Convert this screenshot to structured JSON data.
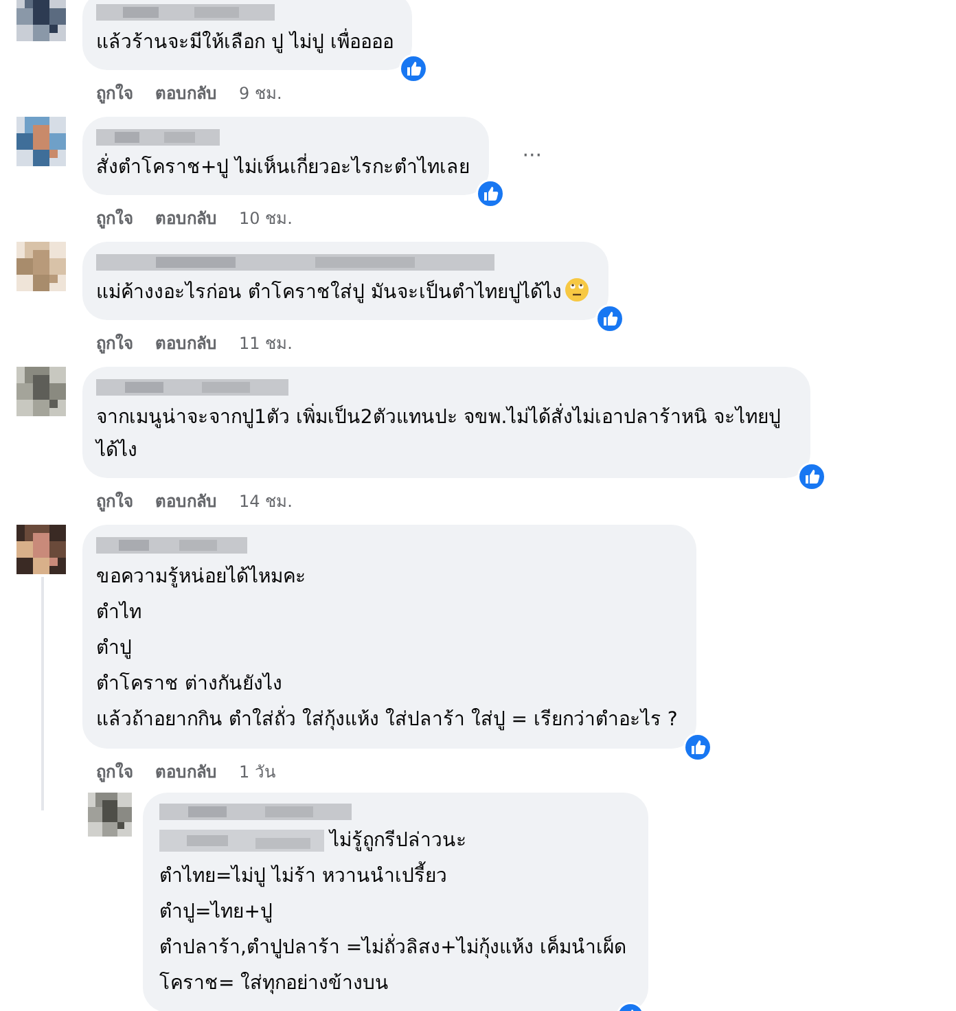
{
  "comments": [
    {
      "text": [
        "แล้วร้านจะมีให้เลือก ปู ไม่ปู เพื่ออออ"
      ],
      "like": "ถูกใจ",
      "reply": "ตอบกลับ",
      "time": "9 ชม.",
      "kind": "text"
    },
    {
      "text": [
        "สั่งตำโคราช+ปู ไม่เห็นเกี่ยวอะไรกะตำไทเลย"
      ],
      "like": "ถูกใจ",
      "reply": "ตอบกลับ",
      "time": "10 ชม.",
      "menu": "···",
      "kind": "text"
    },
    {
      "text": [
        "แม่ค้างงอะไรก่อน ตำโคราชใส่ปู มันจะเป็นตำไทยปูได้ไง"
      ],
      "like": "ถูกใจ",
      "reply": "ตอบกลับ",
      "time": "11 ชม.",
      "kind": "emoji"
    },
    {
      "text": [
        "จากเมนูน่าจะจากปู1ตัว เพิ่มเป็น2ตัวแทนปะ จขพ.ไม่ได้สั่งไม่เอาปลาร้าหนิ จะไทยปูได้ไง"
      ],
      "like": "ถูกใจ",
      "reply": "ตอบกลับ",
      "time": "14 ชม.",
      "kind": "text"
    },
    {
      "text": [
        "ขอความรู้หน่อยได้ไหมคะ",
        "ตำไท",
        "ตำปู",
        "ตำโคราช ต่างกันยังไง",
        "แล้วถ้าอยากกิน ตำใส่ถั่ว ใส่กุ้งแห้ง ใส่ปลาร้า ใส่ปู = เรียกว่าตำอะไร ?"
      ],
      "like": "ถูกใจ",
      "reply": "ตอบกลับ",
      "time": "1 วัน",
      "kind": "text"
    }
  ],
  "reply": {
    "first_line": "ไม่รู้ถูกรีปล่าวนะ",
    "text": [
      "ตำไทย=ไม่ปู ไม่ร้า หวานนำเปรี้ยว",
      "ตำปู=ไทย+ปู",
      "ตำปลาร้า,ตำปูปลาร้า =ไม่ถั่วลิสง+ไม่กุ้งแห้ง เค็มนำเผ็ด",
      "โคราช= ใส่ทุกอย่างข้างบน"
    ]
  }
}
